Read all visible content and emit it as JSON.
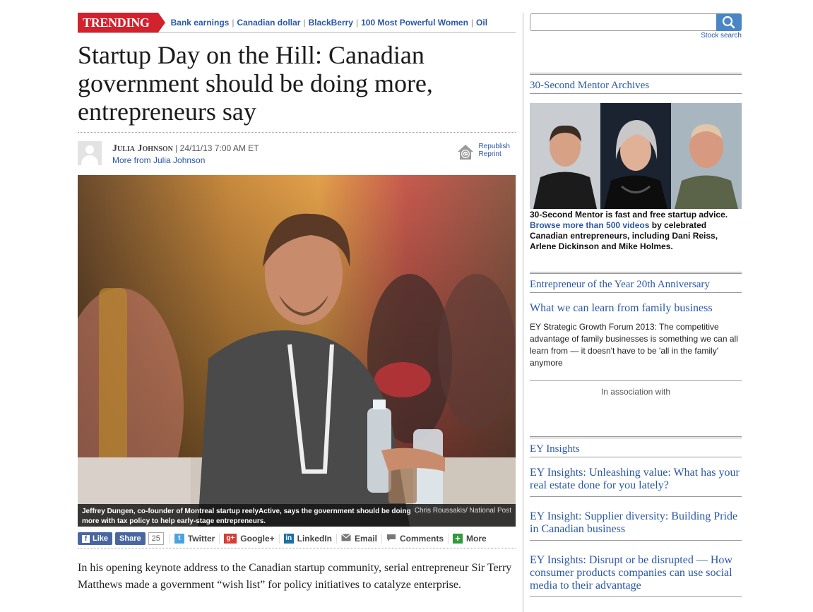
{
  "trending": {
    "badge": "TRENDING",
    "links": [
      "Bank earnings",
      "Canadian dollar",
      "BlackBerry",
      "100 Most Powerful Women",
      "Oil"
    ],
    "separator": "|"
  },
  "article": {
    "headline": "Startup Day on the Hill: Canadian government should be doing more, entrepreneurs say",
    "author": "Julia Johnson",
    "datetime": "| 24/11/13 7:00 AM ET",
    "more_from": "More from Julia Johnson",
    "republish": "Republish",
    "reprint": "Reprint",
    "caption": "Jeffrey Dungen, co-founder of Montreal startup reelyActive, says the government should be doing more with tax policy to help early-stage entrepreneurs.",
    "credit": "Chris Roussakis/ National Post",
    "body": "In his opening keynote address to the Canadian startup community, serial entrepreneur Sir Terry Matthews made a government “wish list” for policy initiatives to catalyze enterprise."
  },
  "share": {
    "like": "Like",
    "share": "Share",
    "count": "25",
    "twitter": "Twitter",
    "google": "Google+",
    "linkedin": "LinkedIn",
    "email": "Email",
    "comments": "Comments",
    "more": "More"
  },
  "sidebar": {
    "search_placeholder": "",
    "stock_search": "Stock search",
    "mentor": {
      "title": "30-Second Mentor Archives",
      "line1": "30-Second Mentor is fast and free startup advice.",
      "link": "Browse more than 500 videos",
      "line2": " by celebrated Canadian entrepreneurs, including Dani Reiss, Arlene Dickinson and Mike Holmes."
    },
    "ey_year": {
      "title": "Entrepreneur of the Year 20th Anniversary",
      "link": "What we can learn from family business",
      "desc": "EY Strategic Growth Forum 2013: The competitive advantage of family businesses is something we can all learn from — it doesn't have to be 'all in the family' anymore",
      "assoc": "In association with"
    },
    "ey_insights": {
      "title": "EY Insights",
      "items": [
        "EY Insights: Unleashing value: What has your real estate done for you lately?",
        "EY Insight: Supplier diversity: Building Pride in Canadian business",
        "EY Insights: Disrupt or be disrupted — How consumer products companies can use social media to their advantage"
      ]
    }
  },
  "colors": {
    "trending_red": "#d2222d",
    "link_blue": "#2a57a5",
    "facebook": "#4a66a0",
    "search_button": "#4a86c5"
  }
}
